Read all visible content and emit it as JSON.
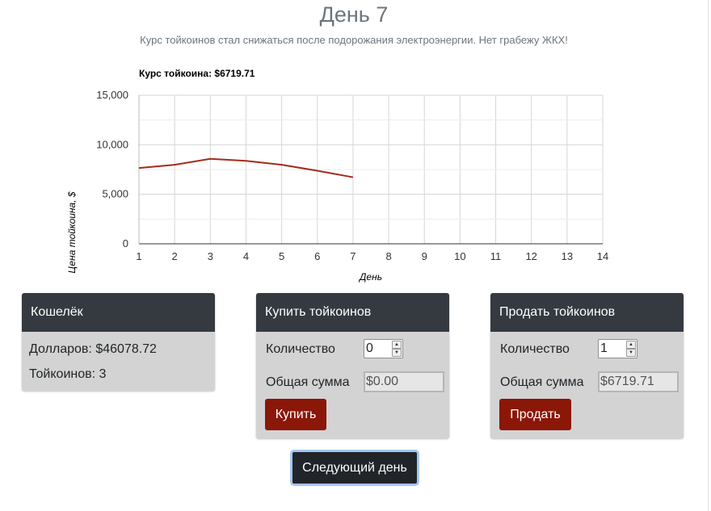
{
  "header": {
    "title": "День 7",
    "subtitle": "Курс тойкоинов стал снижаться после подорожания электроэнергии. Нет грабежу ЖКХ!"
  },
  "chart_data": {
    "type": "line",
    "title": "Курс тойкоина: $6719.71",
    "xlabel": "День",
    "ylabel": "Цена тойкоина, $",
    "x_ticks": [
      1,
      2,
      3,
      4,
      5,
      6,
      7,
      8,
      9,
      10,
      11,
      12,
      13,
      14
    ],
    "y_ticks": [
      "0",
      "5,000",
      "10,000",
      "15,000"
    ],
    "y_tick_values": [
      0,
      5000,
      10000,
      15000
    ],
    "xlim": [
      1,
      14
    ],
    "ylim": [
      0,
      15000
    ],
    "grid": true,
    "series": [
      {
        "color": "#a52a1c",
        "x": [
          1,
          2,
          3,
          4,
          5,
          6,
          7
        ],
        "values": [
          7650,
          7980,
          8580,
          8380,
          7980,
          7380,
          6719.71
        ]
      }
    ]
  },
  "wallet": {
    "title": "Кошелёк",
    "dollars": "Долларов: $46078.72",
    "coins": "Тойкоинов: 3"
  },
  "buy": {
    "title": "Купить тойкоинов",
    "quantity_label": "Количество",
    "quantity_value": "0",
    "total_label": "Общая сумма",
    "total_value": "$0.00",
    "button": "Купить"
  },
  "sell": {
    "title": "Продать тойкоинов",
    "quantity_label": "Количество",
    "quantity_value": "1",
    "total_label": "Общая сумма",
    "total_value": "$6719.71",
    "button": "Продать"
  },
  "next_day_button": "Следующий день",
  "colors": {
    "accent": "#8b1709",
    "header": "#343a40",
    "card": "#d3d3d3"
  }
}
